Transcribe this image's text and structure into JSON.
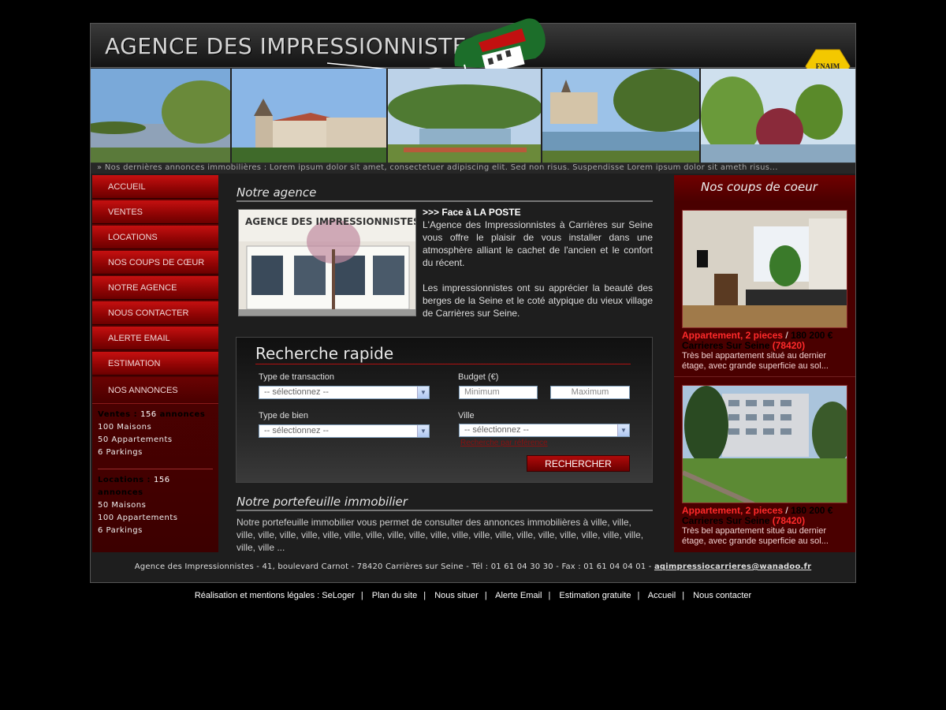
{
  "header": {
    "title": "AGENCE DES IMPRESSIONNISTES",
    "badge": "FNAIM",
    "ticker": "» Nos dernières annonces immobilières : Lorem ipsum dolor sit amet, consectetuer adipiscing elit. Sed non risus. Suspendisse Lorem ipsum dolor sit ameth risus..."
  },
  "nav": {
    "items": [
      "ACCUEIL",
      "VENTES",
      "LOCATIONS",
      "NOS COUPS DE CŒUR",
      "NOTRE AGENCE",
      "NOUS CONTACTER",
      "ALERTE EMAIL",
      "ESTIMATION"
    ],
    "annonces_label": "NOS ANNONCES",
    "ventes": {
      "head": "Ventes : ",
      "count": "156",
      "suffix": " annonces",
      "lines": [
        "100 Maisons",
        "50 Appartements",
        "6 Parkings"
      ]
    },
    "locations": {
      "head": "Locations : ",
      "count": "156",
      "suffix": " annonces",
      "lines": [
        "50 Maisons",
        "100 Appartements",
        "6 Parkings"
      ]
    }
  },
  "agence": {
    "title": "Notre agence",
    "subtitle": ">>> Face à LA POSTE",
    "para1": "L'Agence des Impressionnistes à Carrières sur Seine vous offre le plaisir de vous installer dans une atmosphère alliant le cachet de l'ancien et le confort du récent.",
    "para2": "Les impressionnistes ont su apprécier la beauté des berges de la Seine et le coté atypique du vieux village de Carrières sur Seine.",
    "storefront_sign": "AGENCE DES IMPRESSIONNISTES"
  },
  "search": {
    "title": "Recherche rapide",
    "transaction_label": "Type de transaction",
    "transaction_value": "-- sélectionnez --",
    "budget_label": "Budget (€)",
    "min_placeholder": "Minimum",
    "max_placeholder": "Maximum",
    "bien_label": "Type de bien",
    "bien_value": "-- sélectionnez --",
    "ville_label": "Ville",
    "ville_value": "-- sélectionnez --",
    "link": "Recherche par référence",
    "button": "RECHERCHER"
  },
  "portefeuille": {
    "title": "Notre portefeuille immobilier",
    "text": "Notre portefeuille immobilier vous permet de consulter des annonces immobilières à ville, ville, ville, ville, ville, ville, ville, ville, ville, ville, ville, ville, ville, ville, ville, ville, ville, ville, ville, ville, ville, ville, ville ..."
  },
  "coeur": {
    "title": "Nos coups de coeur",
    "listings": [
      {
        "type": "Appartement, 2 pieces",
        "sep": " / ",
        "price": "180 200 €",
        "city": "Carrieres Sur Seine",
        "cp": " (78420)",
        "desc": "Très bel appartement situé au dernier étage, avec grande superficie au sol..."
      },
      {
        "type": "Appartement, 2 pieces",
        "sep": " / ",
        "price": "180 200 €",
        "city": "Carrieres Sur Seine",
        "cp": " (78420)",
        "desc": "Très bel appartement situé au dernier étage, avec grande superficie au sol..."
      }
    ]
  },
  "footer": {
    "address": "Agence des Impressionnistes - 41, boulevard Carnot - 78420 Carrières sur Seine - Tél : 01 61 04 30 30 - Fax : 01 61 04 04 01 - ",
    "email": "aqimpressiocarrieres@wanadoo.fr",
    "links": [
      "Réalisation et mentions légales : SeLoger",
      "Plan du site",
      "Nous situer",
      "Alerte Email",
      "Estimation gratuite",
      "Accueil",
      "Nous contacter"
    ],
    "pipe": "|"
  },
  "colors": {
    "accent": "#c61010",
    "dark_red": "#4a0000",
    "price_red": "#ff2a2a",
    "background": "#000000"
  }
}
